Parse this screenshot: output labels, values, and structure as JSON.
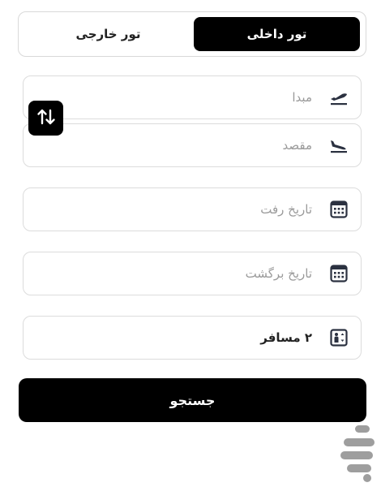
{
  "tabs": {
    "domestic_label": "تور داخلی",
    "foreign_label": "تور خارجی"
  },
  "fields": {
    "origin_placeholder": "مبدا",
    "destination_placeholder": "مقصد",
    "departure_date_placeholder": "تاریخ رفت",
    "return_date_placeholder": "تاریخ برگشت",
    "passengers_value": "۲ مسافر"
  },
  "icons": {
    "origin": "airplane-takeoff-icon",
    "destination": "airplane-landing-icon",
    "departure_date": "calendar-icon",
    "return_date": "calendar-icon",
    "passengers": "passenger-counter-icon",
    "swap": "swap-vertical-icon"
  },
  "search": {
    "label": "جستجو"
  },
  "colors": {
    "primary": "#000000",
    "border": "#dcdcdc",
    "placeholder": "#9a9a9a",
    "icon": "#2b3140"
  }
}
